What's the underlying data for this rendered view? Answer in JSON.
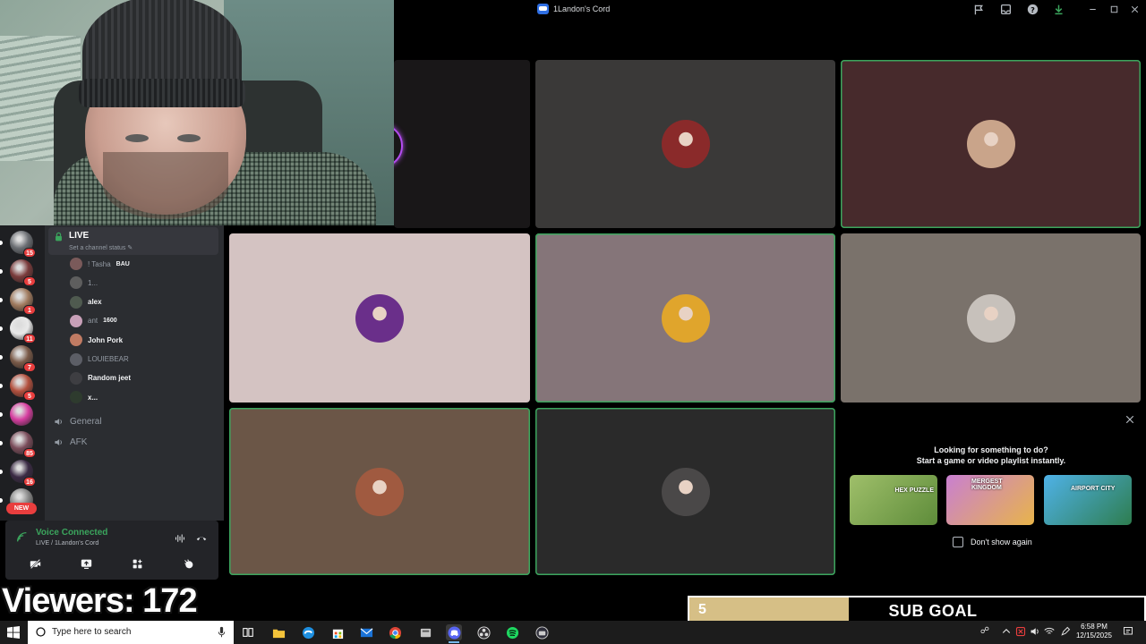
{
  "window": {
    "title": "1Landon's Cord",
    "controls": [
      "flag-icon",
      "inbox-icon",
      "help-icon",
      "download-icon",
      "minimize-icon",
      "maximize-icon",
      "close-icon"
    ]
  },
  "servers": [
    {
      "badge": "15",
      "color": "#6b6e73"
    },
    {
      "badge": "5",
      "color": "#7a3b3b"
    },
    {
      "badge": "1",
      "color": "#a07a5e"
    },
    {
      "badge": "11",
      "color": "#e9e9e9"
    },
    {
      "badge": "7",
      "color": "#7a5a48"
    },
    {
      "badge": "5",
      "color": "#b3503e"
    },
    {
      "badge": "",
      "color": "#d63ea0"
    },
    {
      "badge": "85",
      "color": "#7a4c5a"
    },
    {
      "badge": "16",
      "color": "#3a2a44"
    },
    {
      "badge": "",
      "color": "#8a8a8a"
    }
  ],
  "server_new_label": "NEW",
  "channel": {
    "name": "LIVE",
    "status_placeholder": "Set a channel status",
    "users": [
      {
        "name": "! Tasha",
        "tag": "BAU",
        "active": false,
        "color": "#7a5a5a"
      },
      {
        "name": "1...",
        "tag": "",
        "active": false,
        "color": "#5e5e5e"
      },
      {
        "name": "alex",
        "tag": "",
        "active": true,
        "color": "#4f5a4f"
      },
      {
        "name": "ant",
        "tag": "1600",
        "active": false,
        "color": "#c8a0b8"
      },
      {
        "name": "John Pork",
        "tag": "",
        "active": true,
        "color": "#c07b63"
      },
      {
        "name": "LOUIEBEAR",
        "tag": "",
        "active": false,
        "color": "#5c5e66"
      },
      {
        "name": "Random jeet",
        "tag": "",
        "active": true,
        "color": "#3e3e42"
      },
      {
        "name": "x...",
        "tag": "",
        "active": true,
        "color": "#2e3b2e"
      }
    ],
    "voice_channels": [
      "General",
      "AFK"
    ]
  },
  "voice_panel": {
    "title": "Voice Connected",
    "subtitle": "LIVE / 1Landon's Cord",
    "actions": [
      "camera-off-icon",
      "screen-share-icon",
      "activities-icon",
      "soundboard-icon"
    ]
  },
  "overlay": {
    "viewers": "Viewers: 172",
    "sub_goal_count": "5",
    "sub_goal_label": "SUB GOAL",
    "sub_goal_progress": 0.35
  },
  "tiles": [
    {
      "bg": "#191718",
      "speaking": false,
      "avatar": null
    },
    {
      "bg": "#3a3938",
      "speaking": false,
      "avatar": "#8a2a2a"
    },
    {
      "bg": "#472a2c",
      "speaking": true,
      "avatar": "#c9a48a"
    },
    {
      "bg": "#d4c3c2",
      "speaking": false,
      "avatar": "#6a2f8a"
    },
    {
      "bg": "#857579",
      "speaking": true,
      "avatar": "#e0a52c"
    },
    {
      "bg": "#7a726b",
      "speaking": false,
      "avatar": "#c7c1bb"
    },
    {
      "bg": "#6b5647",
      "speaking": true,
      "avatar": "#a05a40"
    },
    {
      "bg": "#2a2a2a",
      "speaking": true,
      "avatar": "#4a4848"
    }
  ],
  "activity": {
    "line1": "Looking for something to do?",
    "line2": "Start a game or video playlist instantly.",
    "games": [
      {
        "name": "HEX PUZZLE",
        "color1": "#9fbf6a",
        "color2": "#5e8c3a"
      },
      {
        "name": "MERGEST KINGDOM",
        "color1": "#c97fd1",
        "color2": "#e8b44a"
      },
      {
        "name": "AIRPORT CITY",
        "color1": "#4fb2e8",
        "color2": "#2e7d4f"
      }
    ],
    "dont_show": "Don't show again"
  },
  "taskbar": {
    "search_placeholder": "Type here to search",
    "time": "6:58 PM",
    "date": "12/15/2025"
  }
}
